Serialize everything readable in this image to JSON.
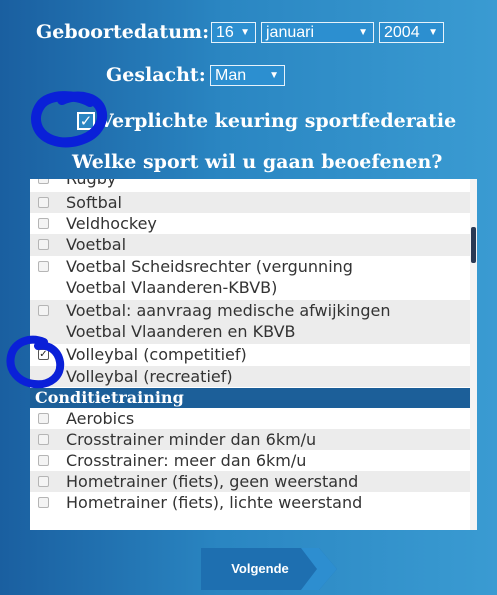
{
  "birthdate": {
    "label": "Geboortedatum:",
    "day": "16",
    "month": "januari",
    "year": "2004"
  },
  "gender": {
    "label": "Geslacht:",
    "value": "Man"
  },
  "mandatory_check": {
    "label": "Verplichte keuring sportfederatie",
    "checked": true
  },
  "sport_question": "Welke sport wil u gaan beoefenen?",
  "sports_list": {
    "partial_top": "Rugby",
    "items": [
      {
        "label": "Softbal",
        "checked": false
      },
      {
        "label": "Veldhockey",
        "checked": false
      },
      {
        "label": "Voetbal",
        "checked": false
      },
      {
        "label": "Voetbal Scheidsrechter (vergunning",
        "label2": "Voetbal Vlaanderen-KBVB)",
        "checked": false
      },
      {
        "label": "Voetbal: aanvraag medische afwijkingen",
        "label2": "Voetbal Vlaanderen en KBVB",
        "checked": false
      },
      {
        "label": "Volleybal (competitief)",
        "checked": true
      },
      {
        "label": "Volleybal (recreatief)",
        "checked": false
      }
    ],
    "group_header": "Conditietraining",
    "group_items": [
      {
        "label": "Aerobics",
        "checked": false
      },
      {
        "label": "Crosstrainer minder dan 6km/u",
        "checked": false
      },
      {
        "label": "Crosstrainer: meer dan 6km/u",
        "checked": false
      },
      {
        "label": "Hometrainer (fiets), geen weerstand",
        "checked": false
      },
      {
        "label": "Hometrainer (fiets), lichte weerstand",
        "checked": false
      }
    ]
  },
  "next_button": "Volgende",
  "colors": {
    "background": "#2a86c2",
    "group_header": "#1c5f99",
    "annotation": "#0a20d8"
  },
  "icons": {
    "select_caret": "caret-down-icon",
    "check": "checkmark-icon"
  }
}
